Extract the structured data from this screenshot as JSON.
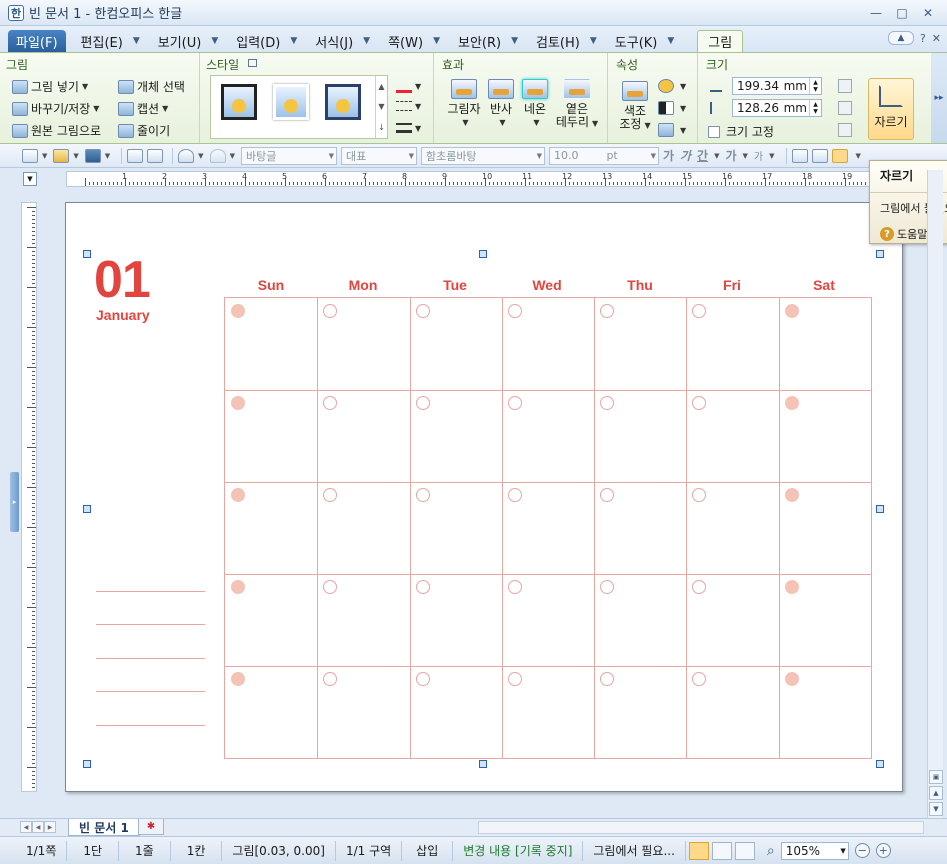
{
  "window": {
    "title": "빈 문서 1 - 한컴오피스 한글",
    "app_icon": "hwp-app-icon",
    "controls": [
      "—",
      "□",
      "✕"
    ]
  },
  "menu": {
    "tabs": [
      {
        "label": "파일(F)",
        "dropdown": false
      },
      {
        "label": "편집(E)",
        "dropdown": true
      },
      {
        "label": "보기(U)",
        "dropdown": true
      },
      {
        "label": "입력(D)",
        "dropdown": true
      },
      {
        "label": "서식(J)",
        "dropdown": true
      },
      {
        "label": "쪽(W)",
        "dropdown": true
      },
      {
        "label": "보안(R)",
        "dropdown": true
      },
      {
        "label": "검토(H)",
        "dropdown": true
      },
      {
        "label": "도구(K)",
        "dropdown": true
      }
    ],
    "active_tab": "그림",
    "right": {
      "help": "?",
      "close": "✕"
    }
  },
  "ribbon": {
    "picture_group": {
      "title": "그림",
      "insert": "그림 넣기",
      "change_save": "바꾸기/저장",
      "original": "원본 그림으로",
      "select_object": "개체 선택",
      "caption": "캡션",
      "shrink": "줄이기"
    },
    "style_group": {
      "title": "스타일"
    },
    "effect_group": {
      "title": "효과",
      "shadow": "그림자",
      "reflect": "반사",
      "neon": "네온",
      "soft_edges_1": "옅은",
      "soft_edges_2": "테두리"
    },
    "attr_group": {
      "title": "속성",
      "color_1": "색조",
      "color_2": "조정"
    },
    "size_group": {
      "title": "크기",
      "width_value": "199.34",
      "height_value": "128.26",
      "unit": "mm",
      "fix_size": "크기 고정"
    },
    "crop_button": "자르기"
  },
  "toolbar": {
    "style_combo": "바탕글",
    "lang_combo": "대표",
    "font_combo": "함초롬바탕",
    "size_value": "10.0",
    "size_unit": "pt",
    "bold": "가",
    "italic": "가",
    "underline": "간",
    "strike": "가",
    "sup": "가"
  },
  "tooltip": {
    "title": "자르기",
    "body": "그림에서 불필요한 부분을 잘라냅니다.",
    "help": "도움말을"
  },
  "calendar": {
    "month_number": "01",
    "month_name": "January",
    "weekdays": [
      "Sun",
      "Mon",
      "Tue",
      "Wed",
      "Thu",
      "Fri",
      "Sat"
    ],
    "weeks": 5,
    "accent_color": "#e2453f",
    "grid_color": "#e6a6a2",
    "weekend_dot_color": "#f4c3b6"
  },
  "doc_tabs": {
    "active": "빈 문서 1"
  },
  "status": {
    "page": "1/1쪽",
    "section_col": "1단",
    "line": "1줄",
    "col": "1칸",
    "object": "그림[0.03, 0.00]",
    "area": "1/1 구역",
    "insert_mode": "삽입",
    "track": "변경 내용 [기록 중지]",
    "message": "그림에서 필요...",
    "zoom": "105%"
  }
}
